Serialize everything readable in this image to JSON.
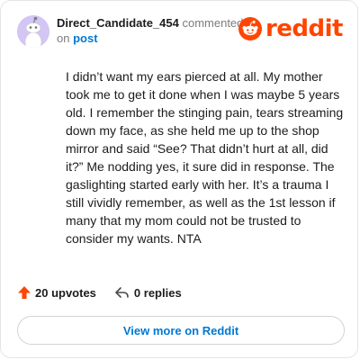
{
  "comment": {
    "username": "Direct_Candidate_454",
    "action_text": "commented",
    "on_text": "on",
    "post_link": "post",
    "body": "I didn’t want my ears pierced at all. My mother took me to get it done when I was maybe 5 years old. I remember the stinging pain, tears streaming down my face, as she held me up to the shop mirror and said “See? That didn’t hurt at all, did it?” Me nodding yes, it sure did in response. The gaslighting started early with her. It’s a trauma I still vividly remember, as well as the 1st lesson if many that my mom could not be trusted to consider my wants. NTA"
  },
  "brand": {
    "wordmark": "reddit",
    "color": "#ff4500"
  },
  "stats": {
    "upvotes": "20 upvotes",
    "replies": "0 replies"
  },
  "cta": {
    "label": "View more on Reddit"
  },
  "icons": {
    "avatar": "snoo-avatar",
    "logo": "reddit-snoo-icon",
    "upvote": "upvote-arrow-icon",
    "reply": "reply-arrow-icon"
  },
  "colors": {
    "accent": "#0079d3",
    "upvote": "#ff4500",
    "avatar_bg": "#d3c6f5",
    "muted": "#7c7c7c"
  }
}
